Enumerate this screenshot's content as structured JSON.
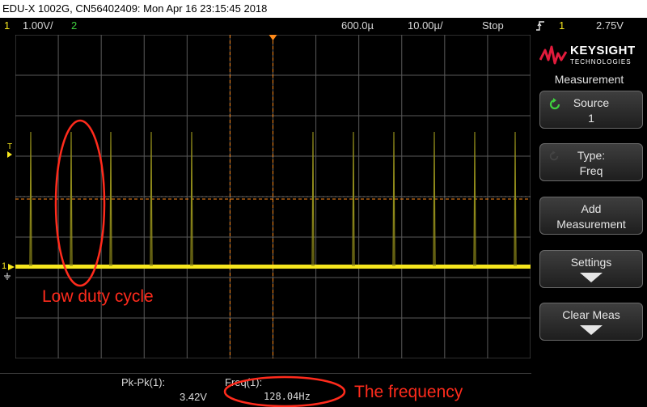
{
  "titlebar": {
    "text": "EDU-X 1002G, CN56402409: Mon Apr 16 23:15:45 2018"
  },
  "status": {
    "ch1_num": "1",
    "ch1_scale": "1.00V/",
    "ch2_num": "2",
    "timebase_delay": "600.0µ",
    "timebase_scale": "10.00µ/",
    "run_state": "Stop",
    "trigger_mode_icon": "trigger-edge-icon",
    "trigger_source": "1",
    "trigger_level": "2.75V"
  },
  "markers": {
    "trigger": "T",
    "channel1": "1"
  },
  "panel": {
    "brand": "KEYSIGHT",
    "brand_sub": "TECHNOLOGIES",
    "title": "Measurement",
    "softkeys": [
      {
        "line1": "Source",
        "line2": "1"
      },
      {
        "line1": "Type:",
        "line2": "Freq"
      },
      {
        "line1": "Add",
        "line2": "Measurement"
      },
      {
        "line1": "Settings"
      },
      {
        "line1": "Clear Meas"
      }
    ]
  },
  "measurements": [
    {
      "label": "Pk-Pk(1):",
      "value": "3.42V"
    },
    {
      "label": "Freq(1):",
      "value": "128.04Hz"
    }
  ],
  "annotations": {
    "duty": "Low duty cycle",
    "freq": "The frequency"
  },
  "colors": {
    "trace": "#f6e61e",
    "annotation": "#ff2b1c",
    "cursor": "#ff8a1a",
    "grid": "#5a5a5a"
  }
}
